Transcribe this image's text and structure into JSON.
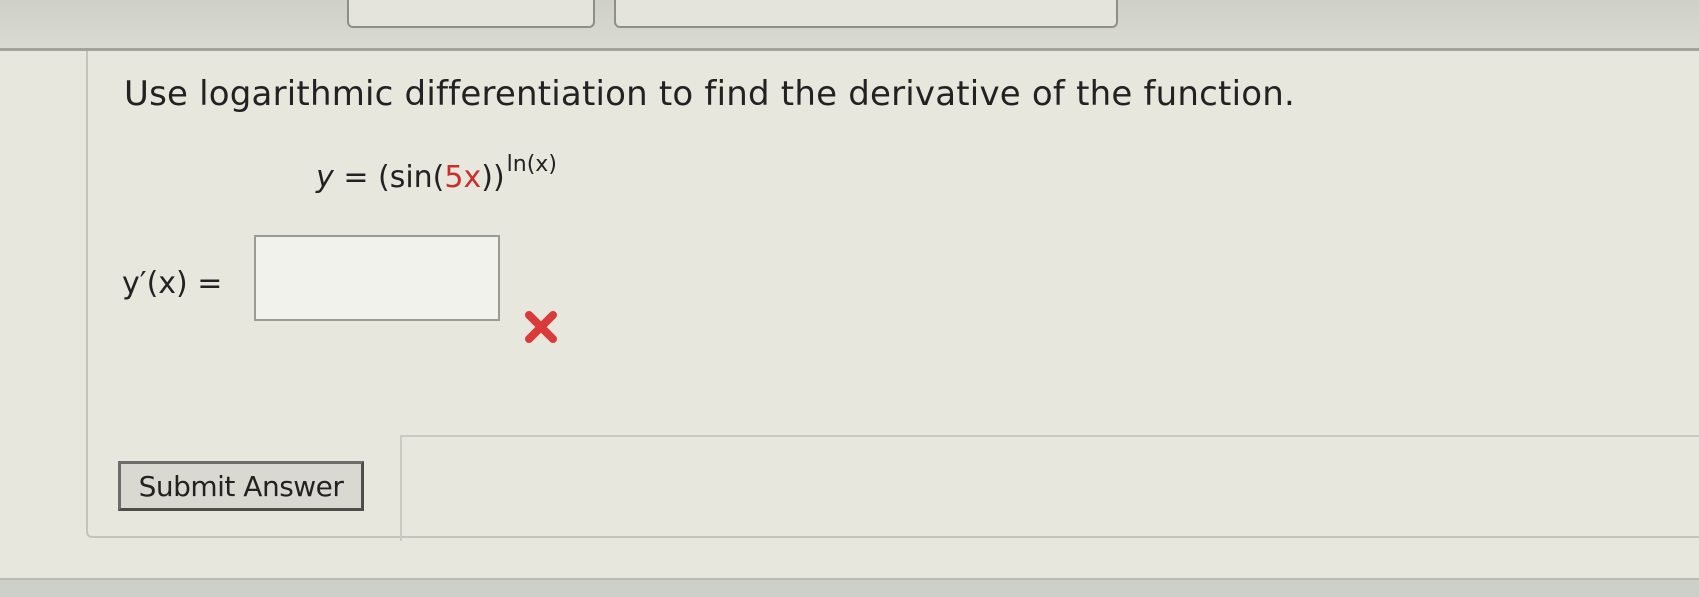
{
  "question": {
    "prompt": "Use logarithmic differentiation to find the derivative of the function."
  },
  "equation": {
    "lhs": "y",
    "equals": "=",
    "base_open": "(sin(",
    "base_arg": "5x",
    "base_close": "))",
    "exponent": "ln(x)"
  },
  "answer": {
    "label": "y′(x) =",
    "value": "",
    "status": "incorrect",
    "status_icon": "red-x-icon",
    "status_color": "#d93a3a"
  },
  "submit": {
    "label": "Submit Answer"
  },
  "colors": {
    "page_bg": "#e8e7de",
    "arg_red": "#c8302c"
  }
}
